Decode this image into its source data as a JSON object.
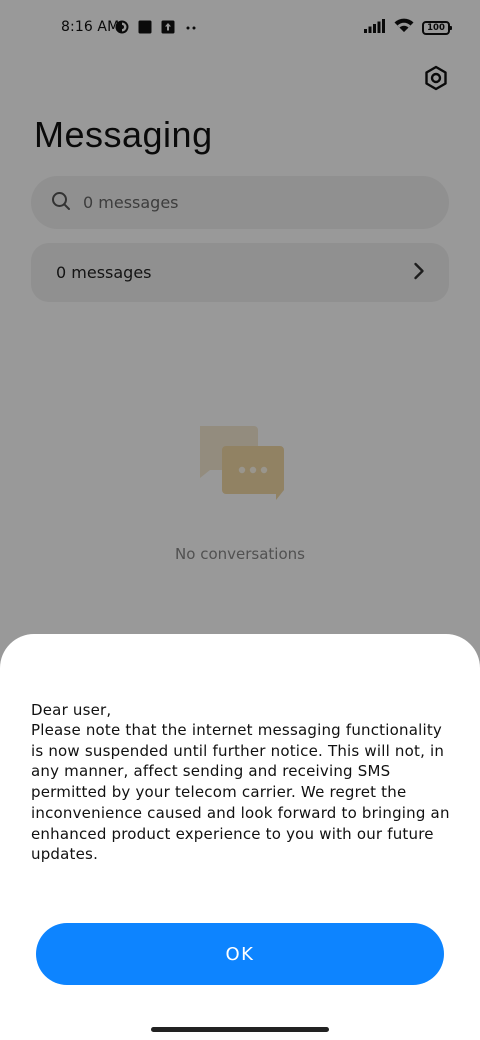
{
  "status_bar": {
    "time": "8:16 AM",
    "battery_level": "100",
    "icons": [
      "notification-app-icon",
      "square-notification-icon",
      "upload-notification-icon",
      "more-dots-icon",
      "signal-icon",
      "wifi-icon",
      "battery-icon"
    ]
  },
  "header": {
    "title": "Messaging",
    "settings_icon": "settings-hexagon-icon"
  },
  "search": {
    "placeholder": "0 messages",
    "icon": "search-icon"
  },
  "messages_row": {
    "label": "0 messages",
    "icon": "chevron-right-icon"
  },
  "empty_state": {
    "label": "No conversations",
    "icon": "chat-bubbles-icon"
  },
  "dialog": {
    "greeting": "Dear user,",
    "body": "Please note that the internet messaging functionality is now suspended until further notice. This will not, in any manner, affect sending and receiving SMS permitted by your telecom carrier. We regret the inconvenience caused and look forward to bringing an enhanced product experience to you with our future updates.",
    "ok_label": "OK"
  },
  "colors": {
    "accent": "#0d84ff",
    "overlay": "rgba(0,0,0,0.4)",
    "illustration": "#f2d9a6"
  }
}
